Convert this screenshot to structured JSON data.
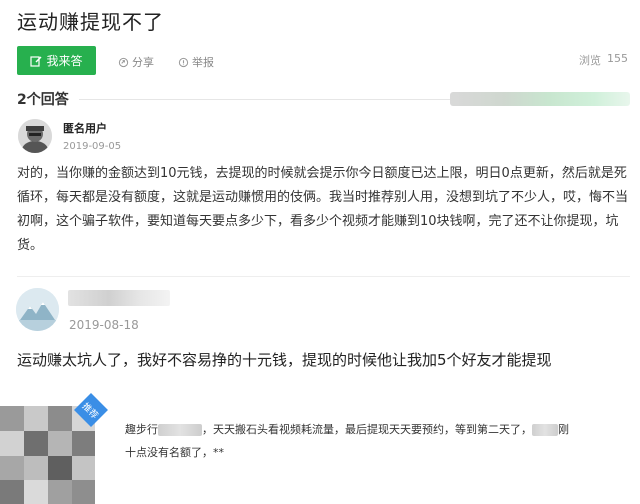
{
  "question": {
    "title": "运动赚提现不了"
  },
  "actions": {
    "answer_label": "我来答",
    "share_label": "分享",
    "report_label": "举报"
  },
  "stats": {
    "views_label": "浏览",
    "views_count": "155"
  },
  "answers_header": {
    "count_label": "2个回答"
  },
  "answers": [
    {
      "user": "匿名用户",
      "date": "2019-09-05",
      "content": "对的，当你赚的金额达到10元钱，去提现的时候就会提示你今日额度已达上限，明日0点更新，然后就是死循环，每天都是没有额度，这就是运动赚惯用的伎俩。我当时推荐别人用，没想到坑了不少人，哎，悔不当初啊，这个骗子软件，要知道每天要点多少下，看多少个视频才能赚到10块钱啊，完了还不让你提现，坑货。"
    },
    {
      "user": "",
      "date": "2019-08-18",
      "content": "运动赚太坑人了，我好不容易挣的十元钱，提现的时候他让我加5个好友才能提现"
    }
  ],
  "comment": {
    "tag": "推荐",
    "part1": "趣步行",
    "part2": "，天天搬石头看视频耗流量，最后提现天天要预约，等到第二天了，",
    "part3": "刚",
    "part4": "十点没有名额了，**"
  },
  "colors": {
    "brand_green": "#27b04e",
    "tag_blue": "#3a8ee6"
  }
}
